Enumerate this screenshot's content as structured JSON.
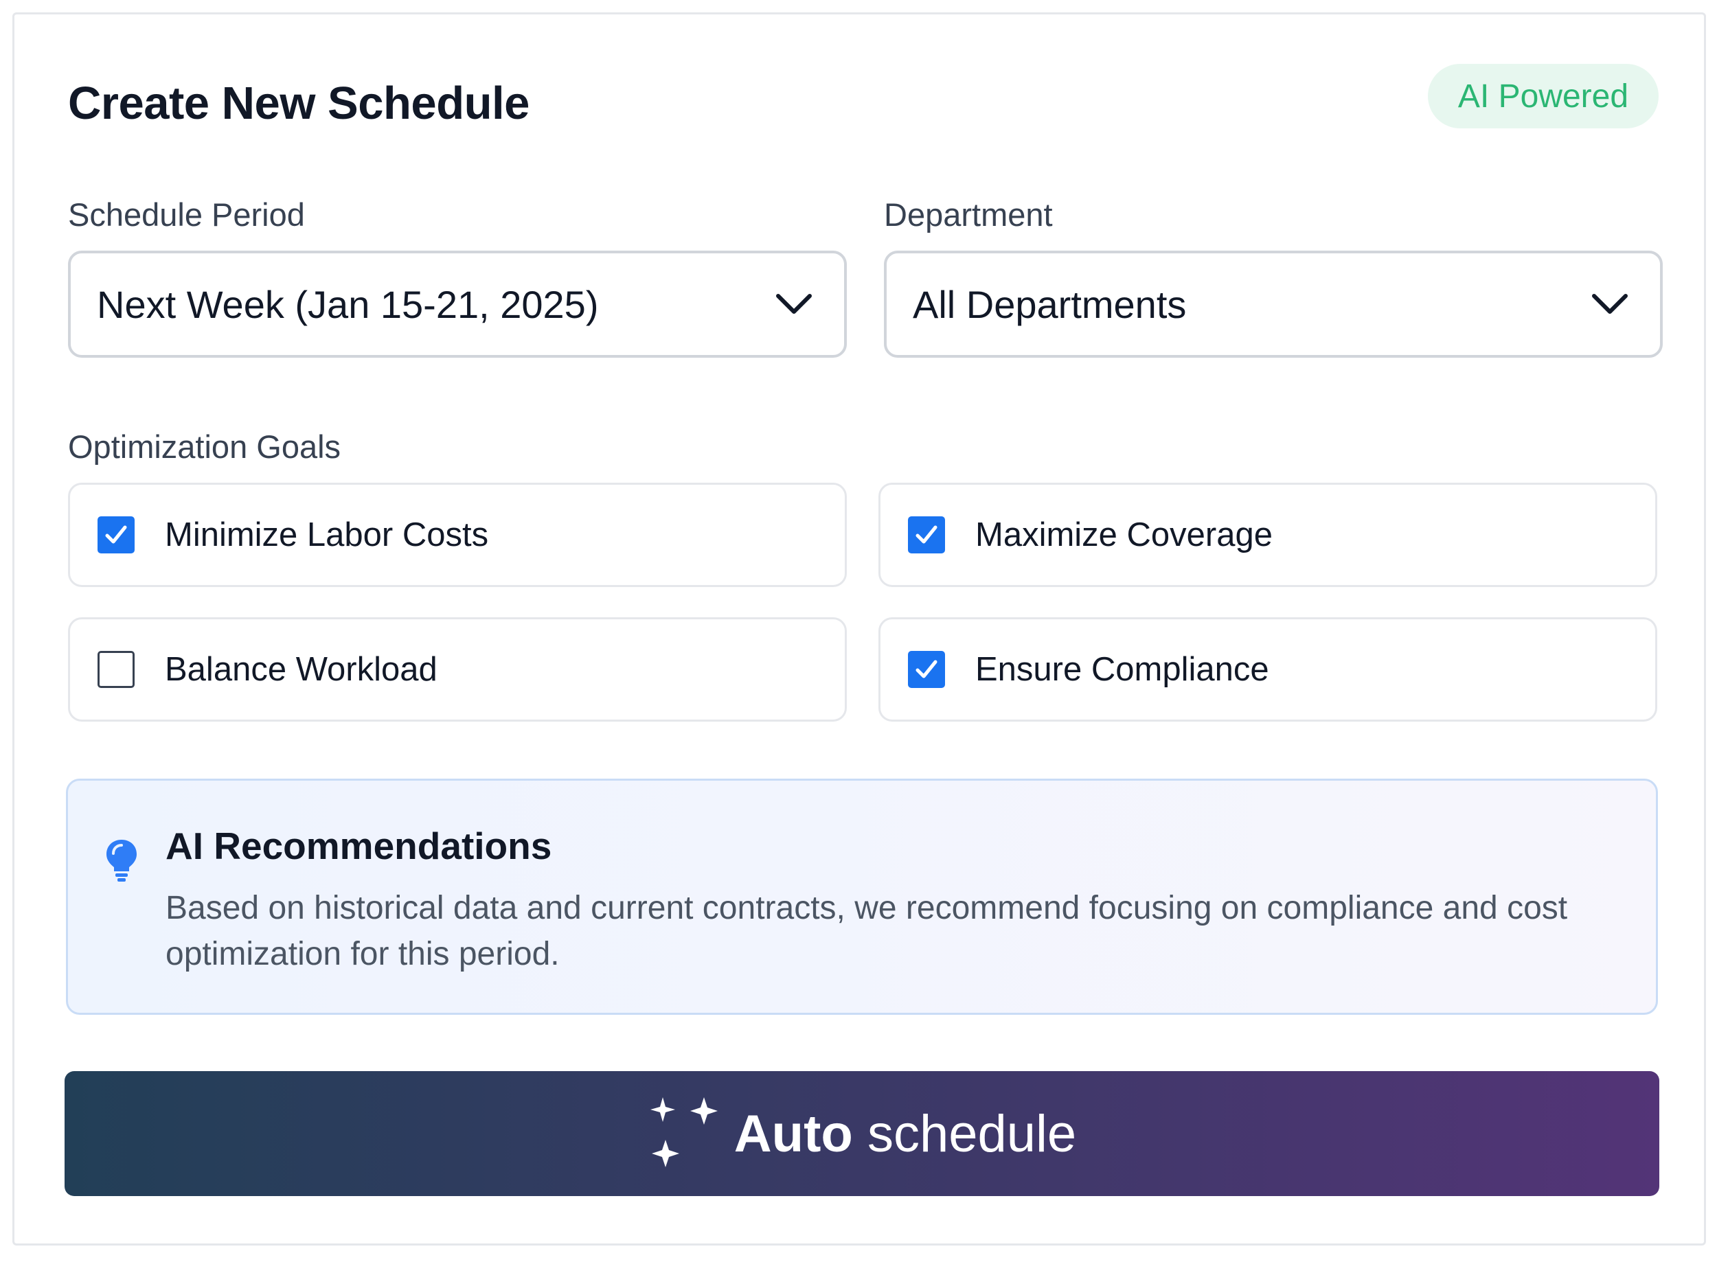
{
  "header": {
    "title": "Create New Schedule",
    "badge": "AI Powered"
  },
  "fields": {
    "period": {
      "label": "Schedule Period",
      "value": "Next Week (Jan 15-21, 2025)"
    },
    "department": {
      "label": "Department",
      "value": "All Departments"
    }
  },
  "goals": {
    "label": "Optimization Goals",
    "items": [
      {
        "label": "Minimize Labor Costs",
        "checked": true
      },
      {
        "label": "Maximize Coverage",
        "checked": true
      },
      {
        "label": "Balance Workload",
        "checked": false
      },
      {
        "label": "Ensure Compliance",
        "checked": true
      }
    ]
  },
  "recommendation": {
    "title": "AI Recommendations",
    "text": "Based on historical data and current contracts, we recommend focusing on compliance and cost optimization for this period.",
    "icon": "lightbulb-icon"
  },
  "action": {
    "label_bold": "Auto",
    "label_rest": " schedule",
    "icon": "sparkles-icon"
  },
  "colors": {
    "accent": "#1a73f0",
    "badge_bg": "#e7f7ef",
    "badge_text": "#2bb673",
    "button_gradient_start": "#223f57",
    "button_gradient_end": "#533477"
  }
}
